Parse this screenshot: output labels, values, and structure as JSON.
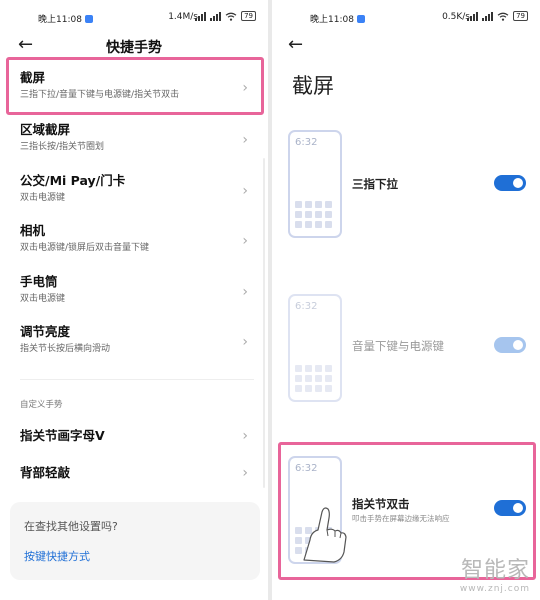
{
  "left": {
    "status": {
      "time": "晚上11:08",
      "net": "1.4M/s",
      "battery": "79"
    },
    "title": "快捷手势",
    "items": [
      {
        "title": "截屏",
        "subtitle": "三指下拉/音量下键与电源键/指关节双击"
      },
      {
        "title": "区域截屏",
        "subtitle": "三指长按/指关节圈划"
      },
      {
        "title": "公交/Mi Pay/门卡",
        "subtitle": "双击电源键"
      },
      {
        "title": "相机",
        "subtitle": "双击电源键/锁屏后双击音量下键"
      },
      {
        "title": "手电筒",
        "subtitle": "双击电源键"
      },
      {
        "title": "调节亮度",
        "subtitle": "指关节长按后横向滑动"
      }
    ],
    "custom_section": "自定义手势",
    "custom_items": [
      {
        "title": "指关节画字母V"
      },
      {
        "title": "背部轻敲"
      }
    ],
    "search_card": {
      "question": "在查找其他设置吗?",
      "link": "按键快捷方式"
    }
  },
  "right": {
    "status": {
      "time": "晚上11:08",
      "net": "0.5K/s",
      "battery": "79"
    },
    "title": "截屏",
    "options": [
      {
        "label": "三指下拉",
        "desc": "",
        "clock": "6:32",
        "enabled": true,
        "dimmed": false
      },
      {
        "label": "音量下键与电源键",
        "desc": "",
        "clock": "6:32",
        "enabled": true,
        "dimmed": true
      },
      {
        "label": "指关节双击",
        "desc": "叩击手势在屏幕边缘无法响应",
        "clock": "6:32",
        "enabled": true,
        "dimmed": false
      }
    ]
  },
  "watermark": {
    "cn": "智能家",
    "url": "www.znj.com"
  },
  "colors": {
    "highlight": "#e8659a",
    "accent": "#1f6fd6",
    "toggle_dim": "#a6c5ee"
  }
}
